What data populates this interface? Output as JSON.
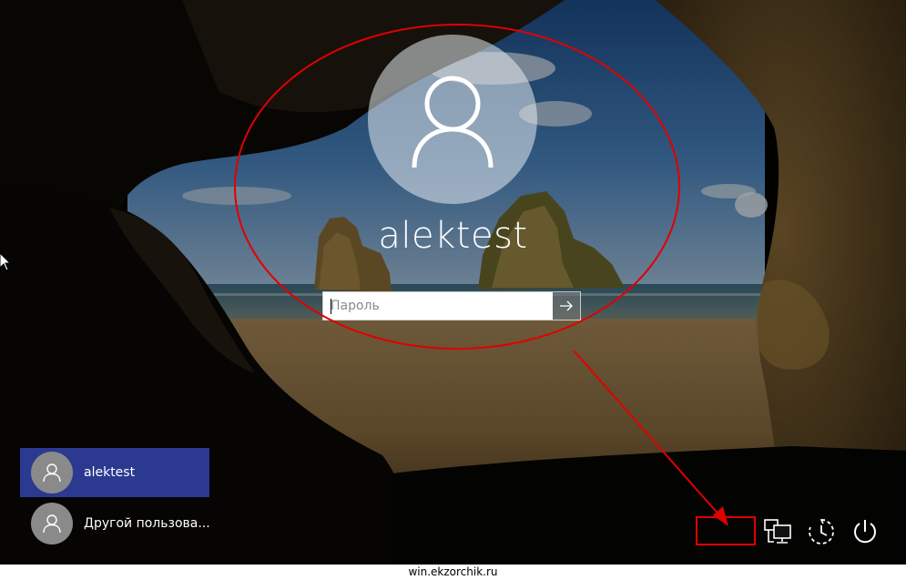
{
  "login": {
    "username": "alektest",
    "password_placeholder": "Пароль"
  },
  "user_list": [
    {
      "name": "alektest",
      "selected": true
    },
    {
      "name": "Другой пользова...",
      "selected": false
    }
  ],
  "tray": {
    "icons": [
      "network-icon",
      "ease-of-access-icon",
      "power-icon"
    ]
  },
  "colors": {
    "selected_user_bg": "#2b3990",
    "annotation_red": "#e00000"
  },
  "watermark": "win.ekzorchik.ru"
}
